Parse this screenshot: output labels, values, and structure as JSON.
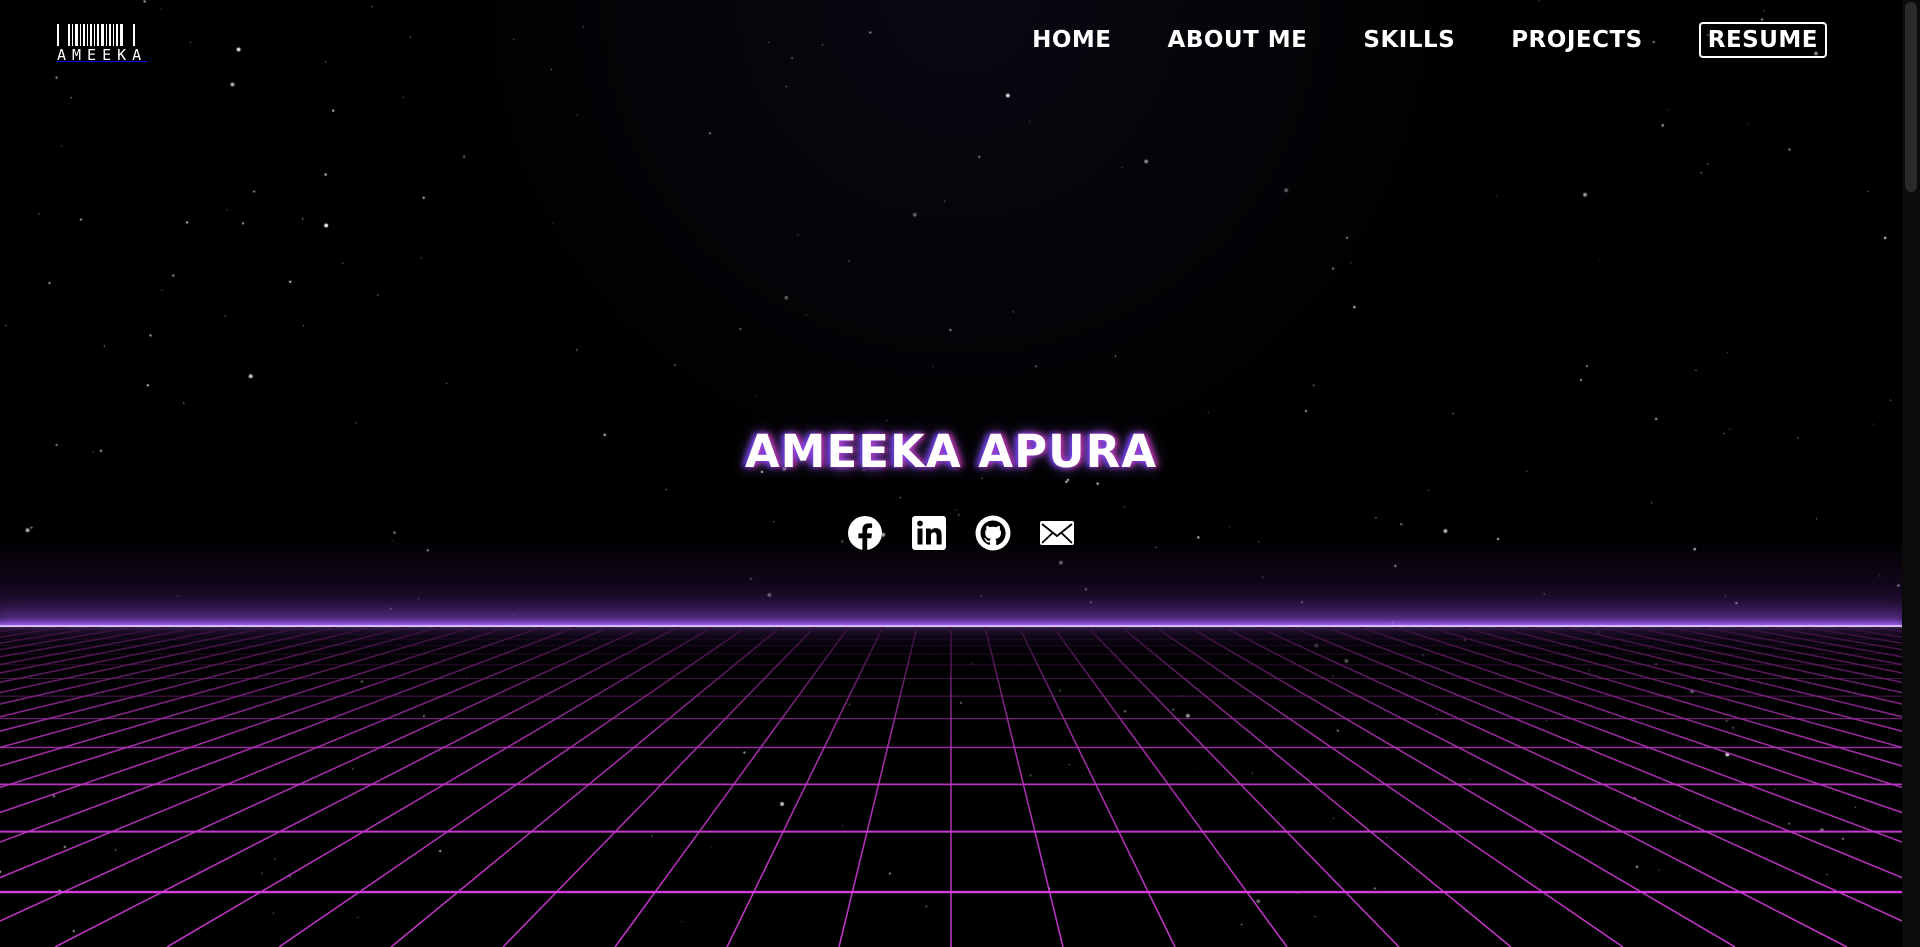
{
  "logo": {
    "text": "AMEEKA"
  },
  "nav": {
    "items": [
      {
        "label": "HOME"
      },
      {
        "label": "ABOUT ME"
      },
      {
        "label": "SKILLS"
      },
      {
        "label": "PROJECTS"
      }
    ],
    "resume_label": "RESUME"
  },
  "hero": {
    "name": "AMEEKA APURA",
    "socials": [
      "facebook-icon",
      "linkedin-icon",
      "github-icon",
      "mail-icon"
    ]
  },
  "colors": {
    "background": "#000000",
    "grid": "#e040e8",
    "horizon": "#d9b8ff",
    "text": "#ffffff"
  }
}
